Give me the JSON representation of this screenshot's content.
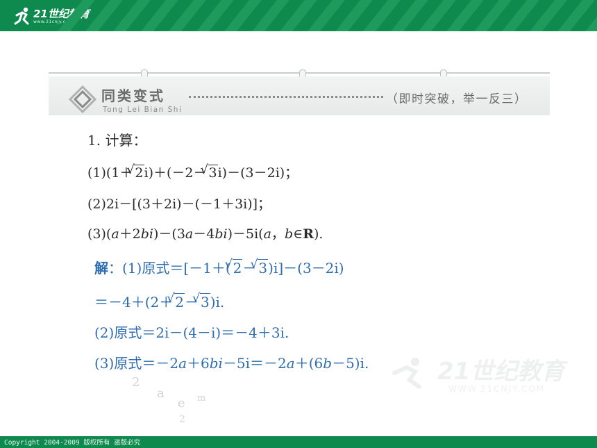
{
  "header": {
    "logo_text": "21世纪教育",
    "logo_sub": "www.21cnjy.com"
  },
  "banner": {
    "title": "同类变式",
    "pinyin": "Tong Lei Bian Shi",
    "right_text": "（即时突破，举一反三）"
  },
  "question": {
    "title": "1. 计算：",
    "item1_a": "(1)(1＋",
    "item1_b": "2",
    "item1_c": "i)＋(－2－",
    "item1_d": "3",
    "item1_e": "i)－(3－2i)；",
    "item2": "(2)2i－[(3＋2i)－(－1＋3i)]；",
    "item3_a": "(3)(",
    "item3_b": "a",
    "item3_c": "＋2",
    "item3_d": "bi",
    "item3_e": ")－(3",
    "item3_f": "a",
    "item3_g": "－4",
    "item3_h": "bi",
    "item3_i": ")－5i(",
    "item3_j": "a",
    "item3_k": "，",
    "item3_l": "b",
    "item3_m": "∈",
    "item3_n": "R",
    "item3_o": ")."
  },
  "solution": {
    "label": "解",
    "l1_a": "：(1)原式＝[－1＋(",
    "l1_b": "2",
    "l1_c": "－",
    "l1_d": "3",
    "l1_e": ")i]－(3－2i)",
    "l2_a": "＝－4＋(2＋",
    "l2_b": "2",
    "l2_c": "－",
    "l2_d": "3",
    "l2_e": ")i.",
    "l3": "(2)原式＝2i－(4－i)＝－4＋3i.",
    "l4_a": "(3)原式＝－2",
    "l4_b": "a",
    "l4_c": "＋6",
    "l4_d": "bi",
    "l4_e": "－5i＝－2",
    "l4_f": "a",
    "l4_g": "＋(6",
    "l4_h": "b",
    "l4_i": "－5)i."
  },
  "watermark": {
    "text": "21世纪教育",
    "url": "WWW.21CNJY.COM"
  },
  "footer": {
    "copyright": "Copyright 2004-2009 版权所有 盗版必究"
  },
  "colors": {
    "brand_green": "#0e8a4e",
    "question_text": "#2a2a2a",
    "answer_blue": "#2e6db0",
    "banner_gray": "#6b6b6b"
  }
}
